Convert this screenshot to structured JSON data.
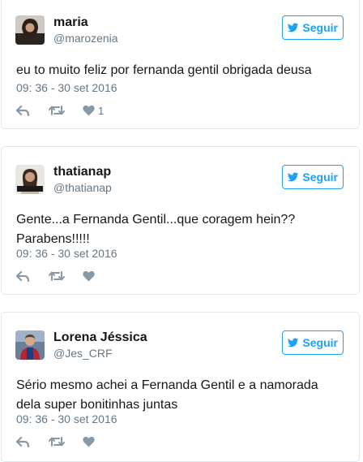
{
  "colors": {
    "accent": "#1da1f2",
    "muted": "#657786",
    "icon": "#8899a6",
    "border": "#e1e8ed"
  },
  "tweets": [
    {
      "name": "maria",
      "handle": "@marozenia",
      "follow_label": "Seguir",
      "text": "eu to muito feliz por fernanda gentil obrigada deusa",
      "time": "09: 36 - 30 set 2016",
      "likes": "1"
    },
    {
      "name": "thatianap",
      "handle": "@thatianap",
      "follow_label": "Seguir",
      "text_lines": [
        "Gente...a Fernanda Gentil...que coragem hein??",
        "Parabens!!!!!"
      ],
      "time": "09: 36 - 30 set 2016",
      "likes": ""
    },
    {
      "name": "Lorena Jéssica",
      "handle": "@Jes_CRF",
      "follow_label": "Seguir",
      "text_lines": [
        "Sério mesmo achei a Fernanda Gentil e a namorada",
        "dela super bonitinhas juntas"
      ],
      "time": "09: 36 - 30 set 2016",
      "likes": ""
    }
  ],
  "icons": {
    "bird": "twitter-bird-icon",
    "reply": "reply-icon",
    "retweet": "retweet-icon",
    "like": "heart-icon"
  }
}
